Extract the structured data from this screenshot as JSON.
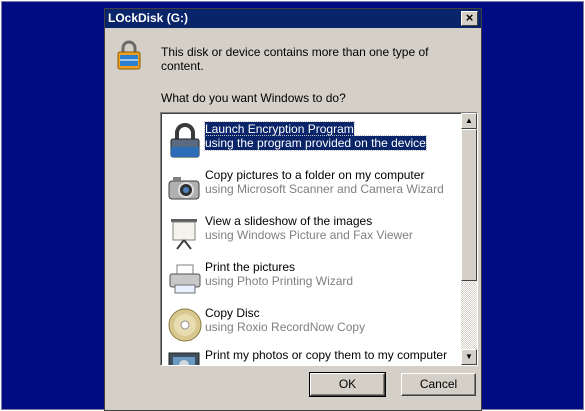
{
  "window": {
    "title": "LOckDisk (G:)",
    "close_label": "×"
  },
  "header": {
    "message": "This disk or device contains more than one type of content.",
    "icon": "lock-icon"
  },
  "prompt": "What do you want Windows to do?",
  "actions": [
    {
      "title": "Launch Encryption Program",
      "subtitle": "using the program provided on the device",
      "icon": "lock-icon",
      "selected": true
    },
    {
      "title": "Copy pictures to a folder on my computer",
      "subtitle": "using Microsoft Scanner and Camera Wizard",
      "icon": "camera-icon"
    },
    {
      "title": "View a slideshow of the images",
      "subtitle": "using Windows Picture and Fax Viewer",
      "icon": "projector-screen-icon"
    },
    {
      "title": "Print the pictures",
      "subtitle": "using Photo Printing Wizard",
      "icon": "printer-icon"
    },
    {
      "title": "Copy Disc",
      "subtitle": "using Roxio RecordNow Copy",
      "icon": "disc-icon"
    },
    {
      "title": "Print my photos or copy them to my computer",
      "subtitle": "",
      "icon": "photo-icon"
    }
  ],
  "buttons": {
    "ok": "OK",
    "cancel": "Cancel"
  },
  "colors": {
    "desktop": "#000b84",
    "titlebar": "#0a246a",
    "dialog": "#d4d0c8",
    "selection": "#0a246a"
  }
}
